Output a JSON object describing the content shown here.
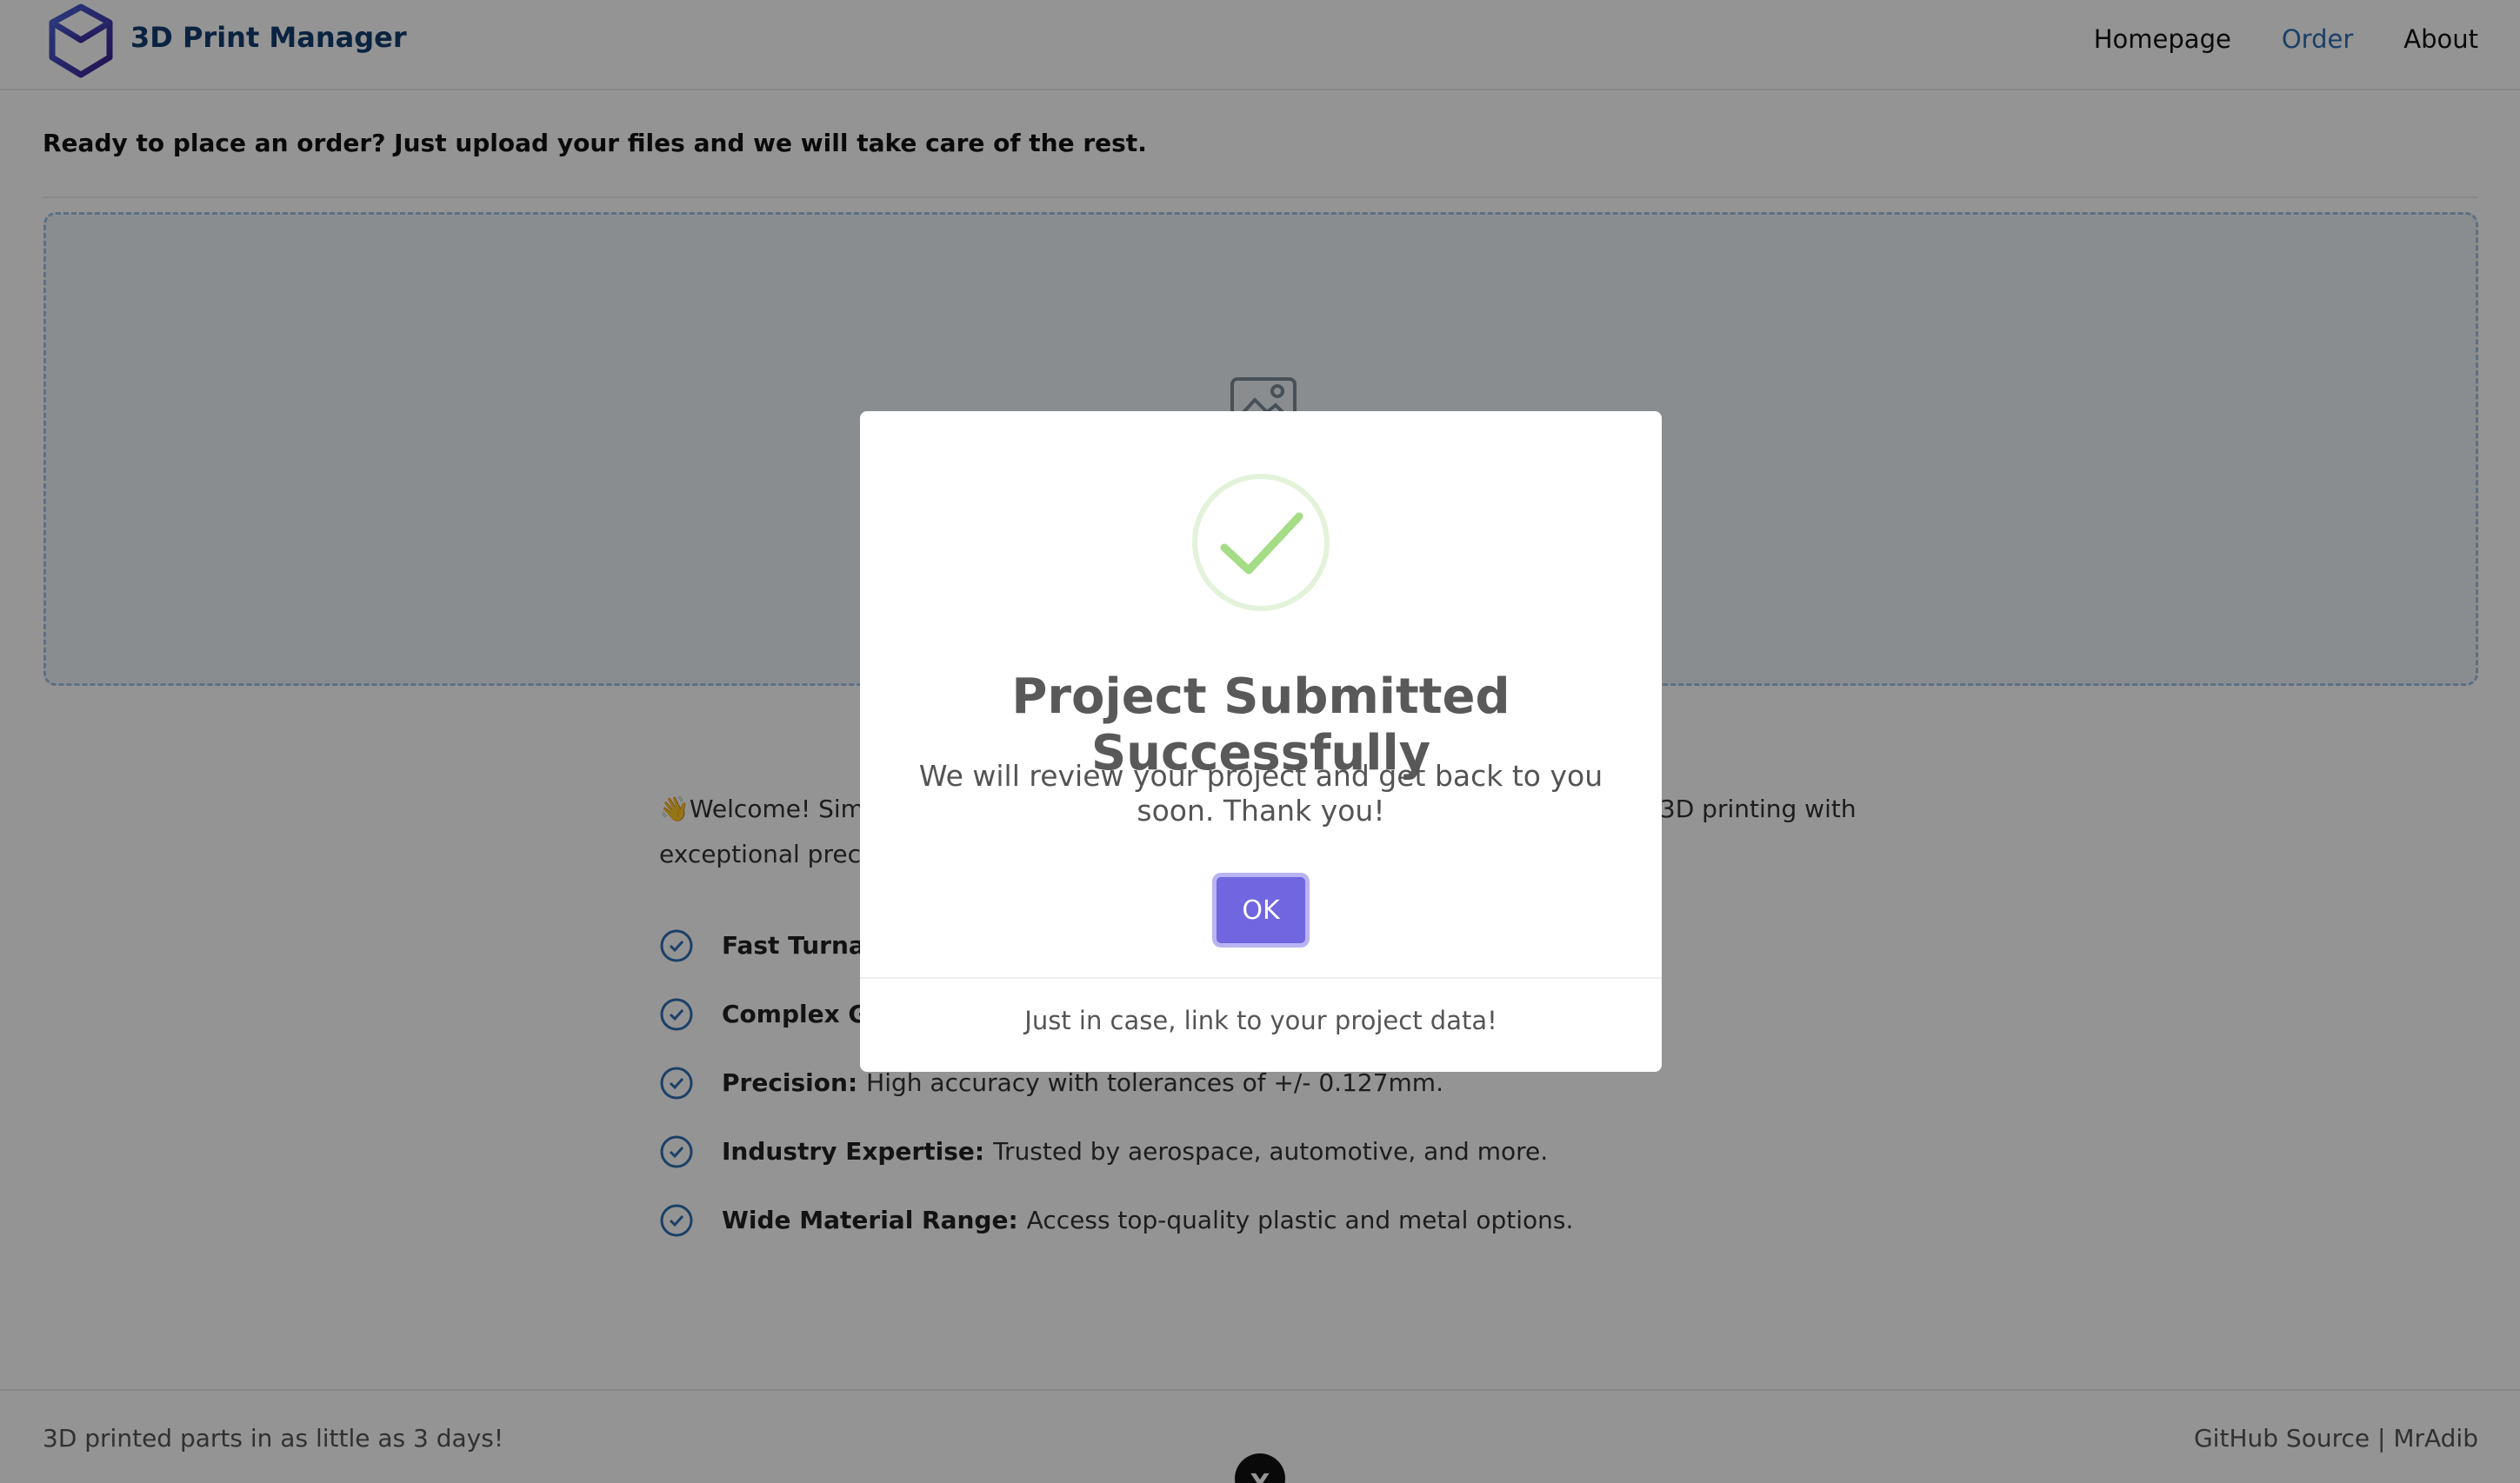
{
  "header": {
    "brand": "3D Print Manager",
    "nav": [
      {
        "label": "Homepage",
        "active": false
      },
      {
        "label": "Order",
        "active": true
      },
      {
        "label": "About",
        "active": false
      }
    ]
  },
  "main": {
    "intro": "Ready to place an order? Just upload your files and we will take care of the rest.",
    "welcome": {
      "emoji": "👋",
      "text": "Welcome! Sim",
      "text_end": "3D printing with",
      "line2": "exceptional precis"
    },
    "features": [
      {
        "title": "Fast Turnarc",
        "desc": ""
      },
      {
        "title": "Complex Ge",
        "desc": ""
      },
      {
        "title": "Precision:",
        "desc": "High accuracy with tolerances of +/- 0.127mm."
      },
      {
        "title": "Industry Expertise:",
        "desc": "Trusted by aerospace, automotive, and more."
      },
      {
        "title": "Wide Material Range:",
        "desc": "Access top-quality plastic and metal options."
      }
    ]
  },
  "footer": {
    "left": "3D printed parts in as little as 3 days!",
    "right_link1": "GitHub Source",
    "separator": " | ",
    "right_link2": "MrAdib",
    "badge": "X"
  },
  "modal": {
    "title": "Project Submitted Successfully",
    "text": "We will review your project and get back to you soon. Thank you!",
    "ok_label": "OK",
    "footer_link": "Just in case, link to your project data!"
  },
  "colors": {
    "brand": "#123d6e",
    "nav_active": "#2f6fb1",
    "ok_button": "#7066e0",
    "success_green": "#a5dc86",
    "dropzone_border": "#9fc1e4"
  }
}
